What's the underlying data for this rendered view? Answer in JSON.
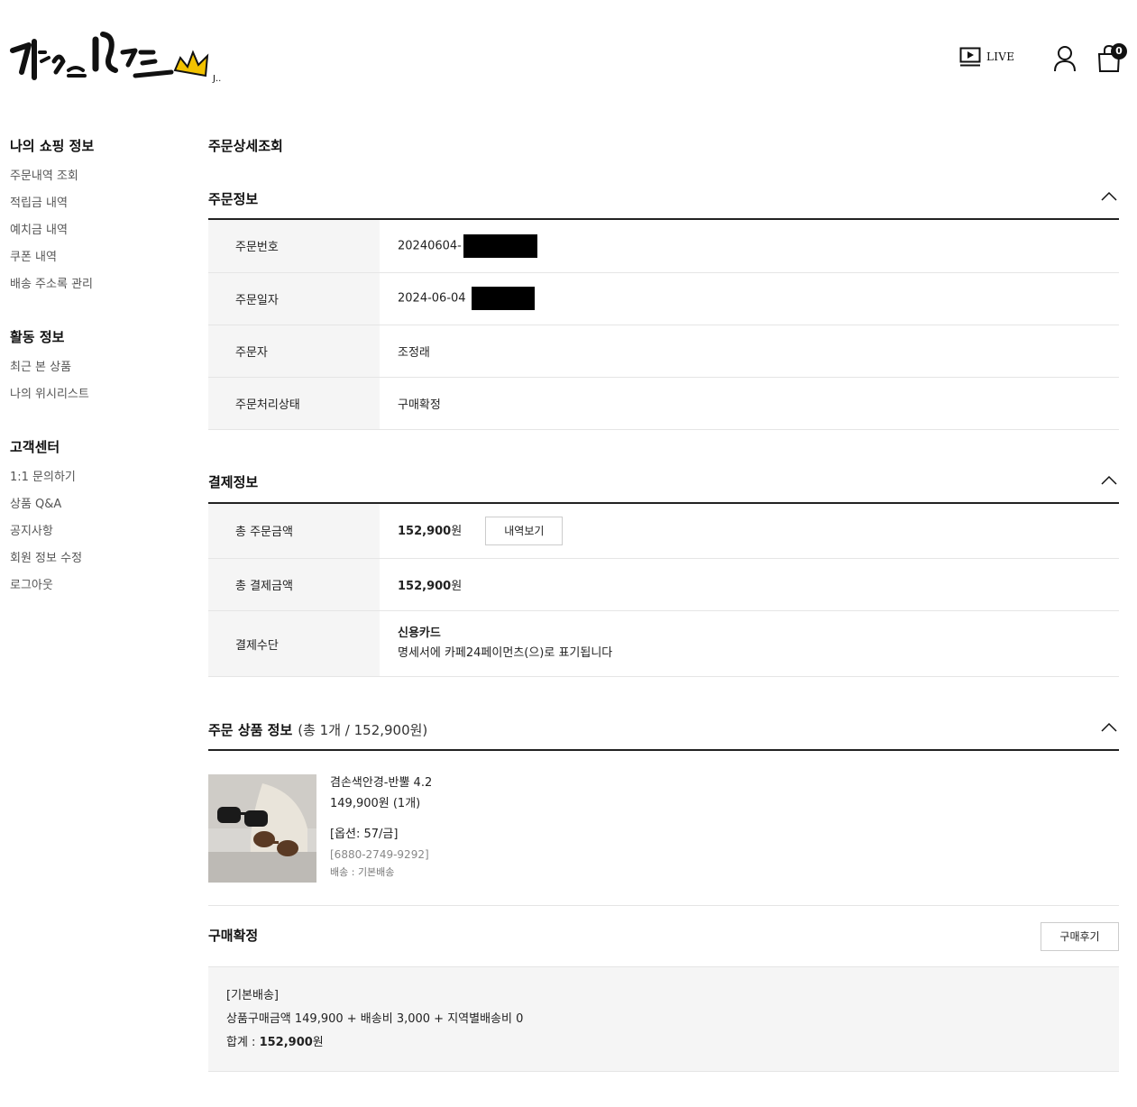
{
  "header": {
    "logo_text": "겸손은 힘드닭",
    "live_label": "LIVE",
    "cart_count": "0"
  },
  "sidebar": {
    "groups": [
      {
        "title": "나의 쇼핑 정보",
        "items": [
          "주문내역 조회",
          "적립금 내역",
          "예치금 내역",
          "쿠폰 내역",
          "배송 주소록 관리"
        ]
      },
      {
        "title": "활동 정보",
        "items": [
          "최근 본 상품",
          "나의 위시리스트"
        ]
      },
      {
        "title": "고객센터",
        "items": [
          "1:1 문의하기",
          "상품 Q&A",
          "공지사항",
          "회원 정보 수정",
          "로그아웃"
        ]
      }
    ]
  },
  "main": {
    "page_title": "주문상세조회",
    "order_info": {
      "title": "주문정보",
      "rows": [
        {
          "label": "주문번호",
          "value": "20240604-"
        },
        {
          "label": "주문일자",
          "value": "2024-06-04"
        },
        {
          "label": "주문자",
          "value": "조정래"
        },
        {
          "label": "주문처리상태",
          "value": "구매확정"
        }
      ]
    },
    "payment_info": {
      "title": "결제정보",
      "total_order_label": "총 주문금액",
      "total_order_value": "152,900",
      "total_order_unit": "원",
      "detail_button": "내역보기",
      "total_pay_label": "총 결제금액",
      "total_pay_value": "152,900",
      "total_pay_unit": "원",
      "method_label": "결제수단",
      "method_value": "신용카드",
      "method_note": "명세서에 카페24페이먼츠(으)로 표기됩니다"
    },
    "product_info": {
      "title": "주문 상품 정보",
      "subtitle": "(총 1개 / 152,900원)",
      "item": {
        "name": "겸손색안경-반뿔 4.2",
        "price": "149,900원 (1개)",
        "option": "[옵션: 57/금]",
        "code": "[6880-2749-9292]",
        "shipping": "배송 : 기본배송"
      }
    },
    "confirm": {
      "title": "구매확정",
      "review_button": "구매후기",
      "ship_type": "[기본배송]",
      "breakdown": "상품구매금액 149,900 + 배송비 3,000 + 지역별배송비 0",
      "total_label": "합계 : ",
      "total_value": "152,900",
      "total_unit": "원"
    }
  }
}
